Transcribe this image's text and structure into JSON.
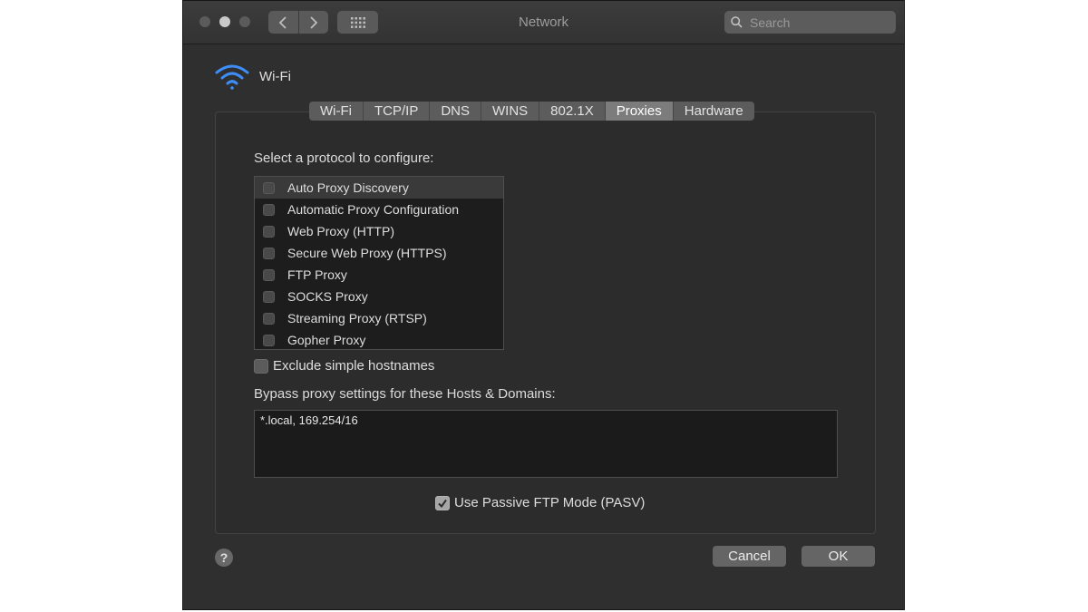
{
  "window": {
    "title": "Network",
    "search_placeholder": "Search"
  },
  "interface": {
    "name": "Wi-Fi",
    "icon": "wifi-icon"
  },
  "tabs": [
    {
      "label": "Wi-Fi",
      "active": false
    },
    {
      "label": "TCP/IP",
      "active": false
    },
    {
      "label": "DNS",
      "active": false
    },
    {
      "label": "WINS",
      "active": false
    },
    {
      "label": "802.1X",
      "active": false
    },
    {
      "label": "Proxies",
      "active": true
    },
    {
      "label": "Hardware",
      "active": false
    }
  ],
  "proxies": {
    "select_label": "Select a protocol to configure:",
    "protocols": [
      {
        "label": "Auto Proxy Discovery",
        "checked": false,
        "selected": true
      },
      {
        "label": "Automatic Proxy Configuration",
        "checked": false,
        "selected": false
      },
      {
        "label": "Web Proxy (HTTP)",
        "checked": false,
        "selected": false
      },
      {
        "label": "Secure Web Proxy (HTTPS)",
        "checked": false,
        "selected": false
      },
      {
        "label": "FTP Proxy",
        "checked": false,
        "selected": false
      },
      {
        "label": "SOCKS Proxy",
        "checked": false,
        "selected": false
      },
      {
        "label": "Streaming Proxy (RTSP)",
        "checked": false,
        "selected": false
      },
      {
        "label": "Gopher Proxy",
        "checked": false,
        "selected": false
      }
    ],
    "exclude_simple_hostnames": {
      "label": "Exclude simple hostnames",
      "checked": false
    },
    "bypass_label": "Bypass proxy settings for these Hosts & Domains:",
    "bypass_value": "*.local, 169.254/16",
    "passive_ftp": {
      "label": "Use Passive FTP Mode (PASV)",
      "checked": true
    }
  },
  "footer": {
    "help": "?",
    "cancel_label": "Cancel",
    "ok_label": "OK"
  },
  "colors": {
    "window_bg": "#2f2f2f",
    "accent_wifi": "#3d8ef7",
    "active_tab": "#7c7c7c"
  }
}
